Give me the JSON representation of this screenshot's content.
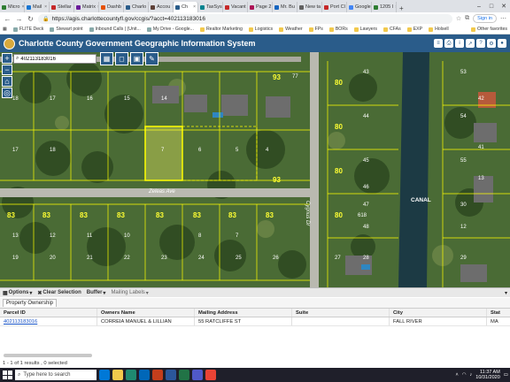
{
  "browser": {
    "tabs": [
      {
        "label": "Micro",
        "color": "#2e7d32"
      },
      {
        "label": "Mail",
        "color": "#1976d2"
      },
      {
        "label": "Stellar",
        "color": "#c62828"
      },
      {
        "label": "Matrix",
        "color": "#6a1b9a"
      },
      {
        "label": "Dashb",
        "color": "#e65100"
      },
      {
        "label": "Charlo",
        "color": "#2a5c8a"
      },
      {
        "label": "Accou",
        "color": "#5d4037"
      },
      {
        "label": "Ch",
        "color": "#2a5c8a",
        "active": true
      },
      {
        "label": "TaxSys",
        "color": "#00838f"
      },
      {
        "label": "Vacant",
        "color": "#c62828"
      },
      {
        "label": "Page 2",
        "color": "#ad1457"
      },
      {
        "label": "Mr. Bu",
        "color": "#1565c0"
      },
      {
        "label": "New ta",
        "color": "#616161"
      },
      {
        "label": "Port Cl",
        "color": "#c62828"
      },
      {
        "label": "Google",
        "color": "#4285f4"
      },
      {
        "label": "1205 I",
        "color": "#2e7d32"
      }
    ],
    "url": "https://agis.charlottecountyfl.gov/ccgis/?acct=402113183016",
    "signin_label": "Sign in",
    "bookmarks": [
      {
        "label": "FLITE Deck",
        "folder": false
      },
      {
        "label": "Stewart point",
        "folder": false
      },
      {
        "label": "Inbound Calls | (Unit...",
        "folder": false
      },
      {
        "label": "My Drive - Google...",
        "folder": false
      },
      {
        "label": "Realtor Marketing",
        "folder": true
      },
      {
        "label": "Logistics",
        "folder": true
      },
      {
        "label": "Weather",
        "folder": true
      },
      {
        "label": "FPs",
        "folder": true
      },
      {
        "label": "BORs",
        "folder": true
      },
      {
        "label": "Lawyers",
        "folder": true
      },
      {
        "label": "CFAs",
        "folder": true
      },
      {
        "label": "EXP",
        "folder": true
      },
      {
        "label": "Holsell",
        "folder": true
      }
    ],
    "other_bookmarks": "Other favorites"
  },
  "app": {
    "title": "Charlotte County Government Geographic Information System"
  },
  "map": {
    "search_value": "402113183016",
    "street_labels": [
      "Zeleas Ave",
      "Cygnus Dr"
    ],
    "canal_label": "CANAL",
    "lot_numbers": [
      "83",
      "83",
      "83",
      "83",
      "83",
      "83",
      "83",
      "83",
      "93",
      "93",
      "80",
      "80",
      "80",
      "18",
      "17",
      "16",
      "15",
      "14",
      "17",
      "18",
      "7",
      "6",
      "5",
      "4",
      "13",
      "12",
      "11",
      "10",
      "8",
      "7",
      "43",
      "44",
      "45",
      "46",
      "47",
      "48",
      "53",
      "54",
      "55",
      "618",
      "77",
      "80",
      "19",
      "20",
      "21",
      "22",
      "23",
      "24",
      "25",
      "26",
      "27",
      "28",
      "29",
      "30",
      "12",
      "13",
      "41",
      "42"
    ]
  },
  "toolbar": {
    "options": "Options",
    "clear_selection": "Clear Selection",
    "buffer": "Buffer",
    "mailing_labels": "Mailing Labels"
  },
  "panel": {
    "tab": "Property Ownership",
    "columns": [
      "Parcel ID",
      "Owners Name",
      "Mailing Address",
      "Suite",
      "City",
      "Stat"
    ],
    "rows": [
      [
        "402113183016",
        "CORREIA MANUEL & LILLIAN",
        "55 RATCLIFFE ST",
        "",
        "FALL RIVER",
        "MA"
      ]
    ],
    "footer": "1 - 1 of 1 results , 0 selected"
  },
  "taskbar": {
    "search_placeholder": "Type here to search",
    "time": "11:37 AM",
    "date": "10/31/2020"
  }
}
